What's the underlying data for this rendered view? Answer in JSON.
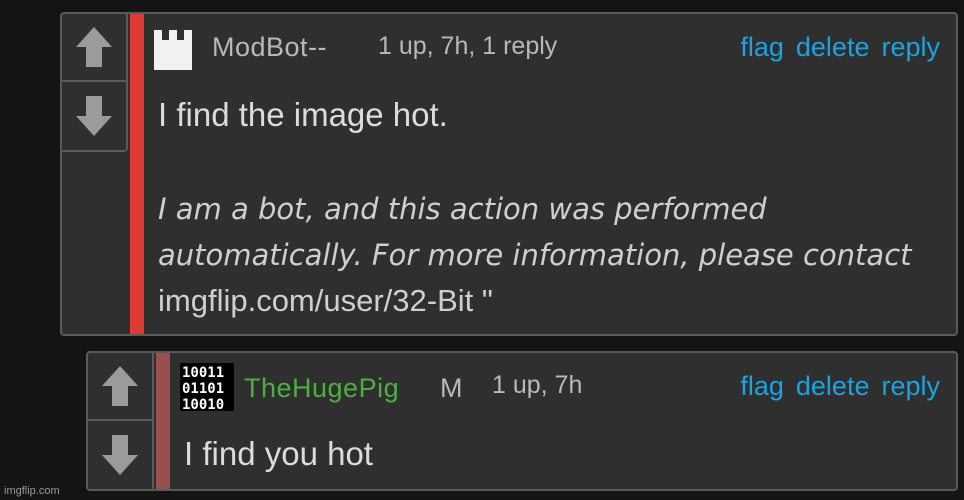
{
  "comments": [
    {
      "username": "ModBot--",
      "meta": "1 up, 7h, 1 reply",
      "actions": {
        "flag": "flag",
        "delete": "delete",
        "reply": "reply"
      },
      "body": "I find the image hot.",
      "note_italic": "I am a bot, and this action was performed automatically. For more information, please contact",
      "note_plain": " imgflip.com/user/32-Bit \""
    },
    {
      "username": "TheHugePig",
      "mod_badge": "M",
      "meta": "1 up, 7h",
      "actions": {
        "flag": "flag",
        "delete": "delete",
        "reply": "reply"
      },
      "body": "I find you hot",
      "avatar_text": [
        "10011",
        "01101",
        "10010"
      ]
    }
  ],
  "watermark": "imgflip.com",
  "colors": {
    "accent_link": "#1aa3e0",
    "modbot_bar": "#e03a35",
    "reply_bar": "#9a4f4f",
    "username_green": "#4caf3e"
  }
}
